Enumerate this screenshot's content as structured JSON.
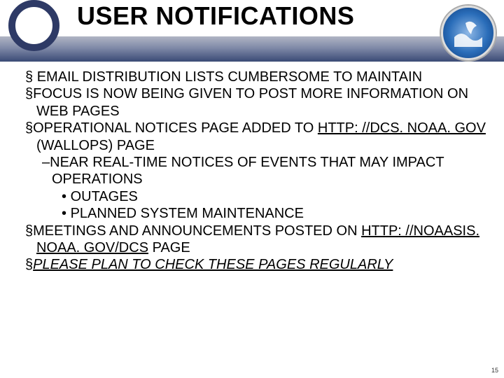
{
  "title": "USER NOTIFICATIONS",
  "logo_name": "NOAA",
  "bullets": {
    "b1": "EMAIL DISTRIBUTION LISTS CUMBERSOME TO MAINTAIN",
    "b2": "FOCUS IS NOW BEING GIVEN TO POST MORE INFORMATION ON WEB PAGES",
    "b3_pre": "OPERATIONAL NOTICES PAGE ADDED TO ",
    "b3_link": "HTTP: //DCS. NOAA. GOV",
    "b3_post": " (WALLOPS) PAGE",
    "b3a": "NEAR REAL-TIME NOTICES OF EVENTS THAT MAY IMPACT OPERATIONS",
    "b3a1": "OUTAGES",
    "b3a2": "PLANNED SYSTEM MAINTENANCE",
    "b4_pre": "MEETINGS AND ANNOUNCEMENTS POSTED ON ",
    "b4_link": "HTTP: //NOAASIS. NOAA. GOV/DCS",
    "b4_post": " PAGE",
    "b5": "PLEASE PLAN TO CHECK THESE PAGES REGULARLY"
  },
  "glyph": {
    "section": "§",
    "dash": "–",
    "dot": "•"
  },
  "page_number": "15"
}
